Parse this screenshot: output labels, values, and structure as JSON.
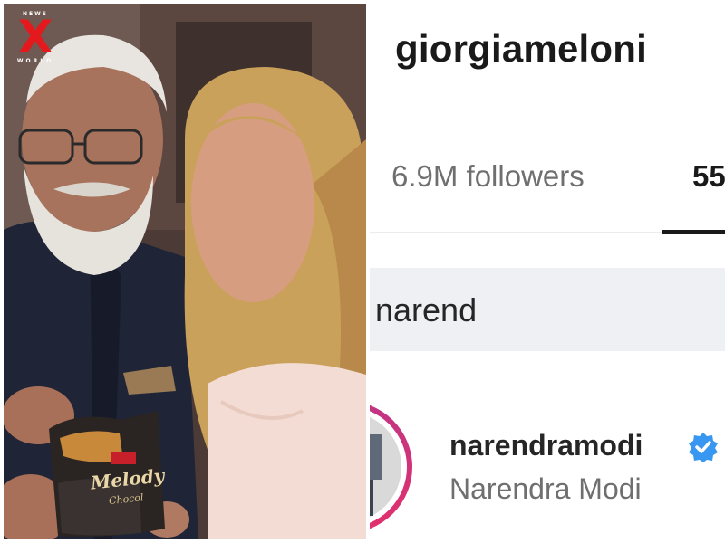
{
  "news_logo": {
    "top_text": "NEWS",
    "mark": "X",
    "bottom_text": "WORLD",
    "mark_color": "#e4191e"
  },
  "photo": {
    "package_label": "Melody",
    "package_sub": "Chocol"
  },
  "profile": {
    "username": "giorgiameloni",
    "followers_label": "6.9M followers",
    "following_count_partial": "55"
  },
  "search": {
    "query": "narend"
  },
  "result": {
    "username": "narendramodi",
    "full_name": "Narendra Modi",
    "verified_icon": "verified-badge-icon",
    "verified_color": "#3897f0",
    "avatar_ring_color": "#c13584"
  }
}
